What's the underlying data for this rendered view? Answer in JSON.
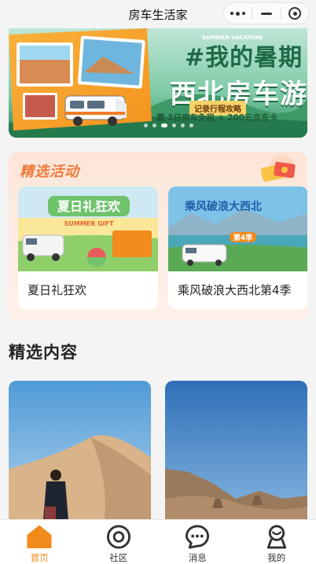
{
  "nav": {
    "title": "房车生活家",
    "more_icon": "more-dots-icon",
    "minimize_icon": "minimize-icon",
    "close_icon": "close-target-icon"
  },
  "banner": {
    "hashtag_title": "#我的暑期",
    "main_title": "西北房车游",
    "small_caption": "SUMMER VACATION",
    "subtitle": "记录行程攻略",
    "promo": "赢 2日房车免租 + 200元京东卡",
    "pages": 6,
    "active_page": 2
  },
  "activities": {
    "title": "精选活动",
    "items": [
      {
        "label": "夏日礼狂欢",
        "image_title": "夏日礼狂欢",
        "image_caption": "SUMMER GIFT"
      },
      {
        "label": "乘风破浪大西北第4季",
        "image_title": "乘风破浪大西北",
        "image_caption": "第4季"
      }
    ]
  },
  "content_section": {
    "title": "精选内容"
  },
  "tabbar": {
    "items": [
      {
        "label": "首页",
        "icon": "home-icon",
        "active": true
      },
      {
        "label": "社区",
        "icon": "community-icon",
        "active": false
      },
      {
        "label": "消息",
        "icon": "message-icon",
        "active": false
      },
      {
        "label": "我的",
        "icon": "profile-icon",
        "active": false
      }
    ]
  },
  "colors": {
    "accent": "#f28a1c",
    "activity_title": "#f07a3a",
    "banner_green": "#1e6a47"
  }
}
